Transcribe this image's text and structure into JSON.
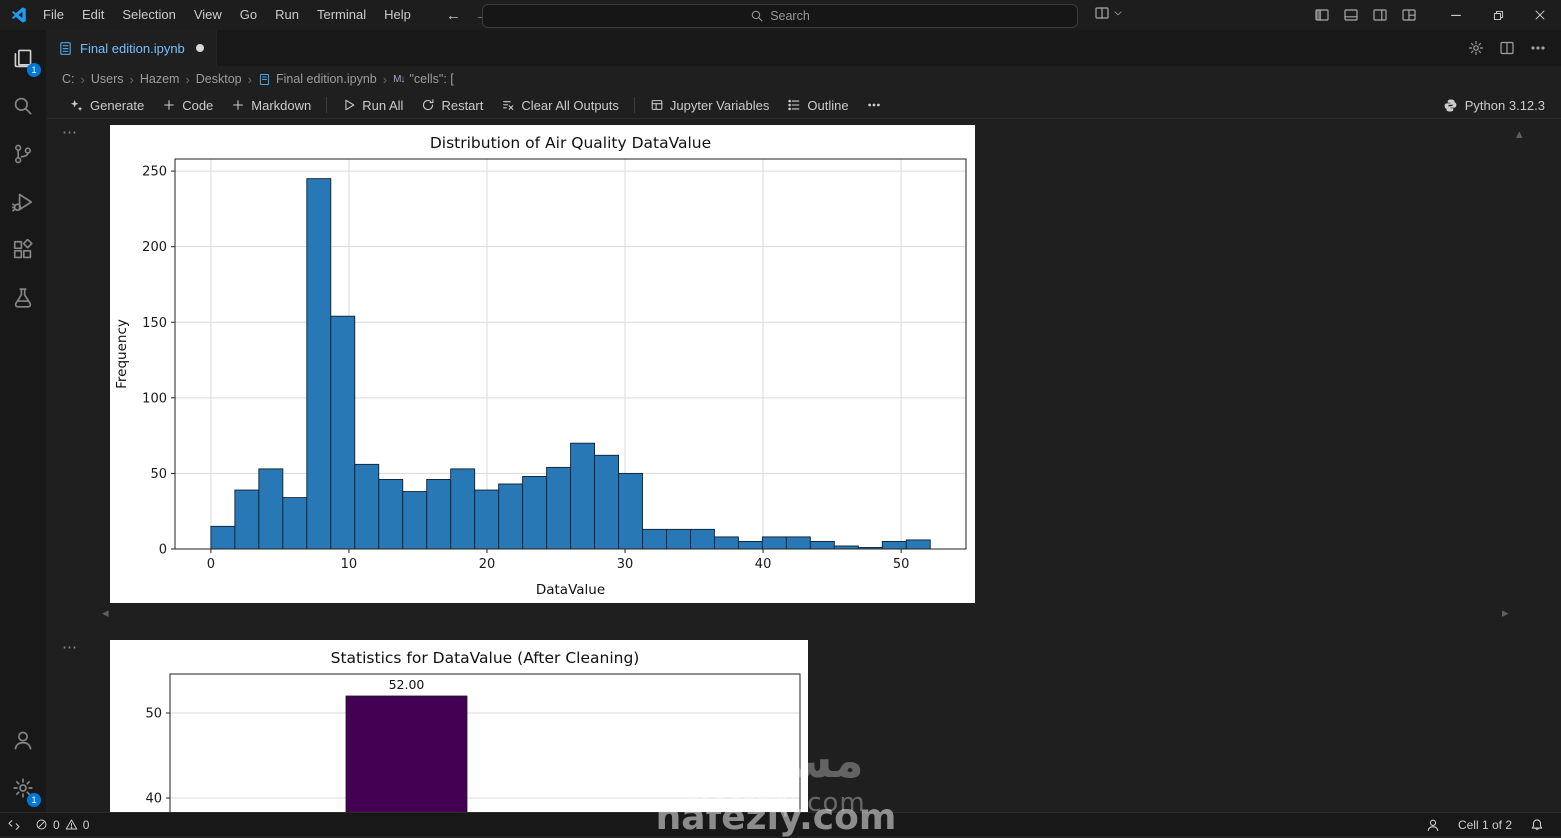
{
  "titlebar": {
    "menus": [
      "File",
      "Edit",
      "Selection",
      "View",
      "Go",
      "Run",
      "Terminal",
      "Help"
    ],
    "search": {
      "placeholder": "Search"
    }
  },
  "activity_bar": {
    "explorer_badge": "1",
    "settings_badge": "1"
  },
  "tab": {
    "label": "Final edition.ipynb"
  },
  "breadcrumb": {
    "drive": "C:",
    "items": [
      "Users",
      "Hazem",
      "Desktop",
      "Final edition.ipynb"
    ],
    "cell_marker": "M↓",
    "cell_path": "\"cells\": ["
  },
  "toolbar": {
    "generate": "Generate",
    "code": "Code",
    "markdown": "Markdown",
    "run_all": "Run All",
    "restart": "Restart",
    "clear_outputs": "Clear All Outputs",
    "variables": "Jupyter Variables",
    "outline": "Outline",
    "interpreter": "Python 3.12.3"
  },
  "status_bar": {
    "errors": "0",
    "warnings": "0",
    "cell_indicator": "Cell 1 of 2"
  },
  "watermark": {
    "arabic": "مستقل",
    "line2": "mostaql.com",
    "line3": "nafezly.com"
  },
  "chart_data": [
    {
      "type": "bar",
      "subtype": "histogram",
      "title": "Distribution of Air Quality DataValue",
      "xlabel": "DataValue",
      "ylabel": "Frequency",
      "xticks": [
        0,
        10,
        20,
        30,
        40,
        50
      ],
      "yticks": [
        0,
        50,
        100,
        150,
        200,
        250
      ],
      "xlim": [
        -2.6,
        54.7
      ],
      "ylim": [
        0,
        258
      ],
      "bin_start": 0,
      "bin_width": 1.737,
      "counts": [
        15,
        39,
        53,
        34,
        245,
        154,
        56,
        46,
        38,
        46,
        53,
        39,
        43,
        48,
        54,
        70,
        62,
        50,
        13,
        13,
        13,
        8,
        5,
        8,
        8,
        5,
        2,
        1,
        5,
        6
      ],
      "bar_color": "#2878b5",
      "bar_edge": "#10212f",
      "grid": true,
      "legend_position": "none"
    },
    {
      "type": "bar",
      "title": "Statistics for DataValue (After Cleaning)",
      "partially_visible": true,
      "visible_yticks": [
        50,
        40
      ],
      "bars": [
        {
          "label": "52.00",
          "value": 52
        }
      ],
      "bar_color": "#440154",
      "grid": true
    }
  ]
}
